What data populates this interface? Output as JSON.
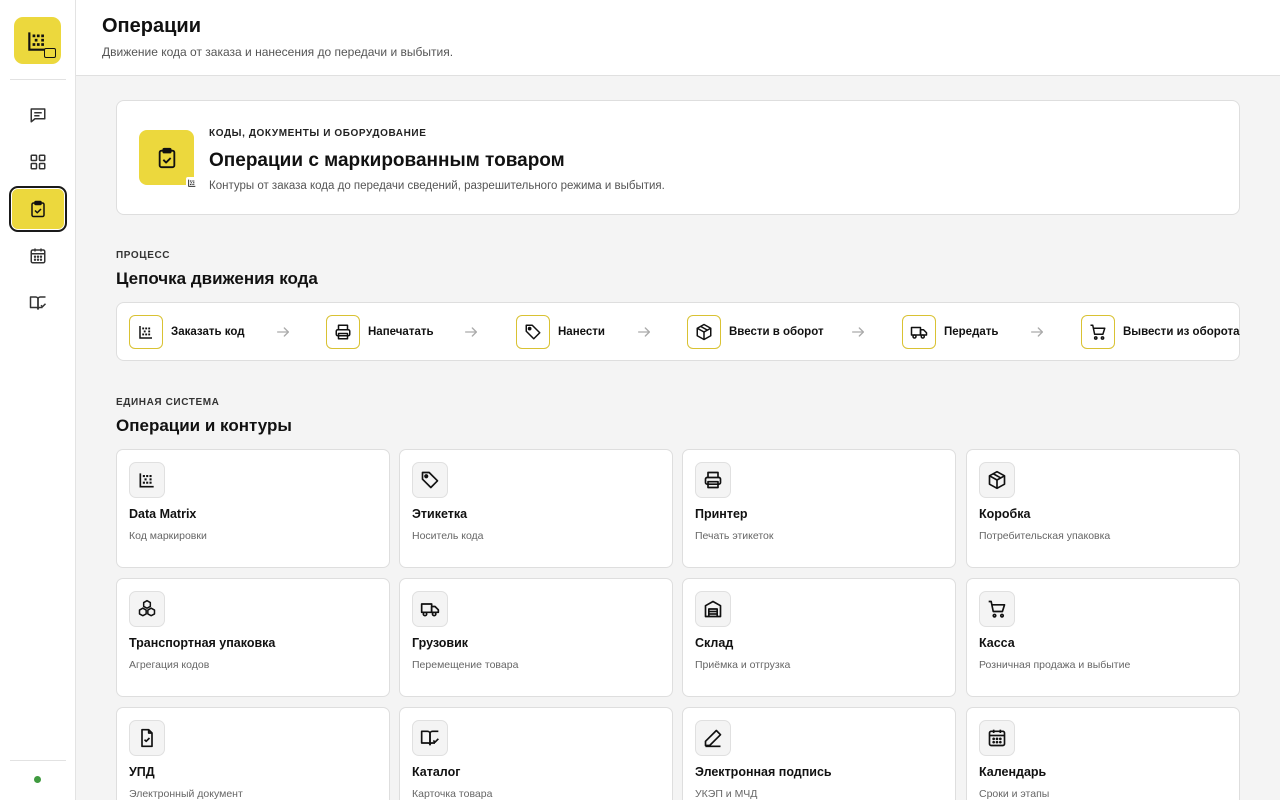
{
  "header": {
    "title": "Операции",
    "subtitle": "Движение кода от заказа и нанесения до передачи и выбытия."
  },
  "sidebar": {
    "items": [
      {
        "icon": "chat-icon",
        "active": false
      },
      {
        "icon": "grid-icon",
        "active": false
      },
      {
        "icon": "clipboard-check-icon",
        "active": true
      },
      {
        "icon": "calendar-icon",
        "active": false
      },
      {
        "icon": "book-check-icon",
        "active": false
      }
    ],
    "status_color": "#3f9a3f"
  },
  "hero": {
    "kicker": "КОДЫ, ДОКУМЕНТЫ И ОБОРУДОВАНИЕ",
    "title": "Операции с маркированным товаром",
    "description": "Контуры от заказа кода до передачи сведений, разрешительного режима и выбытия.",
    "icon": "clipboard-check-icon"
  },
  "process": {
    "kicker": "ПРОЦЕСС",
    "title": "Цепочка движения кода",
    "steps": [
      {
        "label": "Заказать код",
        "icon": "datamatrix-icon"
      },
      {
        "label": "Напечатать",
        "icon": "printer-icon"
      },
      {
        "label": "Нанести",
        "icon": "tag-icon"
      },
      {
        "label": "Ввести в оборот",
        "icon": "box-icon"
      },
      {
        "label": "Передать",
        "icon": "truck-icon"
      },
      {
        "label": "Вывести из оборота",
        "icon": "cart-icon"
      }
    ]
  },
  "system": {
    "kicker": "ЕДИНАЯ СИСТЕМА",
    "title": "Операции и контуры",
    "cards": [
      {
        "title": "Data Matrix",
        "subtitle": "Код маркировки",
        "icon": "datamatrix-icon"
      },
      {
        "title": "Этикетка",
        "subtitle": "Носитель кода",
        "icon": "tag-icon"
      },
      {
        "title": "Принтер",
        "subtitle": "Печать этикеток",
        "icon": "printer-icon"
      },
      {
        "title": "Коробка",
        "subtitle": "Потребительская упаковка",
        "icon": "box-icon"
      },
      {
        "title": "Транспортная упаковка",
        "subtitle": "Агрегация кодов",
        "icon": "boxes-icon"
      },
      {
        "title": "Грузовик",
        "subtitle": "Перемещение товара",
        "icon": "truck-icon"
      },
      {
        "title": "Склад",
        "subtitle": "Приёмка и отгрузка",
        "icon": "warehouse-icon"
      },
      {
        "title": "Касса",
        "subtitle": "Розничная продажа и выбытие",
        "icon": "cart-icon"
      },
      {
        "title": "УПД",
        "subtitle": "Электронный документ",
        "icon": "document-check-icon"
      },
      {
        "title": "Каталог",
        "subtitle": "Карточка товара",
        "icon": "book-check-icon"
      },
      {
        "title": "Электронная подпись",
        "subtitle": "УКЭП и МЧД",
        "icon": "pen-icon"
      },
      {
        "title": "Календарь",
        "subtitle": "Сроки и этапы",
        "icon": "calendar-icon"
      }
    ]
  },
  "colors": {
    "accent": "#ecd83d",
    "accent_border": "#d9c233"
  }
}
